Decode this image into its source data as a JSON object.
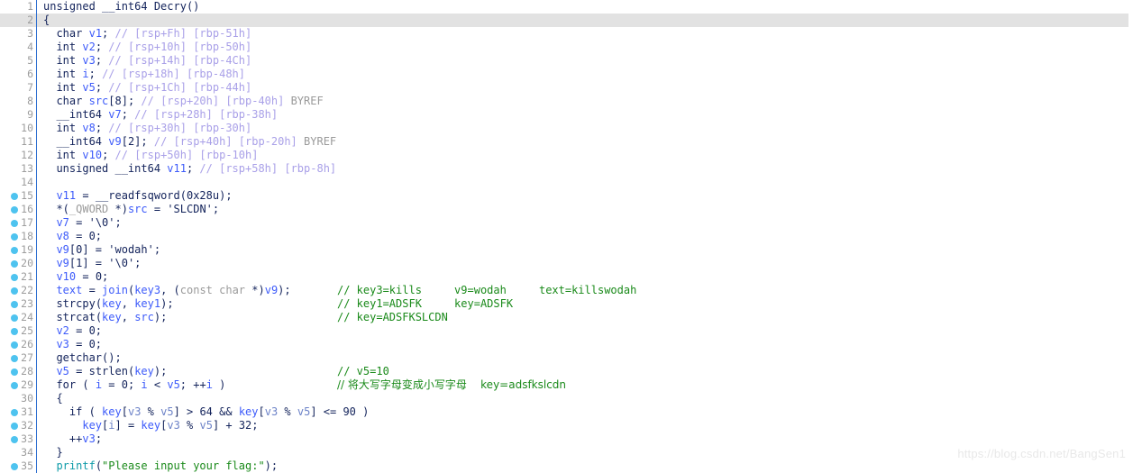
{
  "editor": {
    "title": "IDA Pseudocode - Decry",
    "language": "c",
    "colors": {
      "background": "#ffffff",
      "current_line_highlight": "#e2e2e2",
      "gutter_divider": "#2f6fd0",
      "line_number": "#9d9d9d",
      "breakpoint": "#4ec3ef",
      "keyword": "#13235b",
      "variable": "#3d5bfa",
      "comment_declaration": "#a9a0e8",
      "comment_trailing": "#1a8a1a",
      "string": "#1a8a1a",
      "library_function": "#0d9ba8",
      "gray_token": "#9a9a9a"
    },
    "watermark": "https://blog.csdn.net/BangSen1",
    "lines": [
      {
        "n": "1",
        "bp": false,
        "hl": false,
        "tokens": [
          {
            "t": "unsigned __int64 ",
            "c": "kw"
          },
          {
            "t": "Decry",
            "c": "plain"
          },
          {
            "t": "()",
            "c": "plain"
          }
        ]
      },
      {
        "n": "2",
        "bp": false,
        "hl": true,
        "tokens": [
          {
            "t": "{",
            "c": "plain"
          }
        ]
      },
      {
        "n": "3",
        "bp": false,
        "hl": false,
        "tokens": [
          {
            "t": "  ",
            "c": "plain"
          },
          {
            "t": "char",
            "c": "kw"
          },
          {
            "t": " ",
            "c": "plain"
          },
          {
            "t": "v1",
            "c": "var"
          },
          {
            "t": "; ",
            "c": "plain"
          },
          {
            "t": "// [rsp+Fh] [rbp-51h]",
            "c": "cmt"
          }
        ]
      },
      {
        "n": "4",
        "bp": false,
        "hl": false,
        "tokens": [
          {
            "t": "  ",
            "c": "plain"
          },
          {
            "t": "int",
            "c": "kw"
          },
          {
            "t": " ",
            "c": "plain"
          },
          {
            "t": "v2",
            "c": "var"
          },
          {
            "t": "; ",
            "c": "plain"
          },
          {
            "t": "// [rsp+10h] [rbp-50h]",
            "c": "cmt"
          }
        ]
      },
      {
        "n": "5",
        "bp": false,
        "hl": false,
        "tokens": [
          {
            "t": "  ",
            "c": "plain"
          },
          {
            "t": "int",
            "c": "kw"
          },
          {
            "t": " ",
            "c": "plain"
          },
          {
            "t": "v3",
            "c": "var"
          },
          {
            "t": "; ",
            "c": "plain"
          },
          {
            "t": "// [rsp+14h] [rbp-4Ch]",
            "c": "cmt"
          }
        ]
      },
      {
        "n": "6",
        "bp": false,
        "hl": false,
        "tokens": [
          {
            "t": "  ",
            "c": "plain"
          },
          {
            "t": "int",
            "c": "kw"
          },
          {
            "t": " ",
            "c": "plain"
          },
          {
            "t": "i",
            "c": "var"
          },
          {
            "t": "; ",
            "c": "plain"
          },
          {
            "t": "// [rsp+18h] [rbp-48h]",
            "c": "cmt"
          }
        ]
      },
      {
        "n": "7",
        "bp": false,
        "hl": false,
        "tokens": [
          {
            "t": "  ",
            "c": "plain"
          },
          {
            "t": "int",
            "c": "kw"
          },
          {
            "t": " ",
            "c": "plain"
          },
          {
            "t": "v5",
            "c": "var"
          },
          {
            "t": "; ",
            "c": "plain"
          },
          {
            "t": "// [rsp+1Ch] [rbp-44h]",
            "c": "cmt"
          }
        ]
      },
      {
        "n": "8",
        "bp": false,
        "hl": false,
        "tokens": [
          {
            "t": "  ",
            "c": "plain"
          },
          {
            "t": "char",
            "c": "kw"
          },
          {
            "t": " ",
            "c": "plain"
          },
          {
            "t": "src",
            "c": "var"
          },
          {
            "t": "[8]; ",
            "c": "plain"
          },
          {
            "t": "// [rsp+20h] [rbp-40h] ",
            "c": "cmt"
          },
          {
            "t": "BYREF",
            "c": "gray"
          }
        ]
      },
      {
        "n": "9",
        "bp": false,
        "hl": false,
        "tokens": [
          {
            "t": "  ",
            "c": "plain"
          },
          {
            "t": "__int64",
            "c": "kw"
          },
          {
            "t": " ",
            "c": "plain"
          },
          {
            "t": "v7",
            "c": "var"
          },
          {
            "t": "; ",
            "c": "plain"
          },
          {
            "t": "// [rsp+28h] [rbp-38h]",
            "c": "cmt"
          }
        ]
      },
      {
        "n": "10",
        "bp": false,
        "hl": false,
        "tokens": [
          {
            "t": "  ",
            "c": "plain"
          },
          {
            "t": "int",
            "c": "kw"
          },
          {
            "t": " ",
            "c": "plain"
          },
          {
            "t": "v8",
            "c": "var"
          },
          {
            "t": "; ",
            "c": "plain"
          },
          {
            "t": "// [rsp+30h] [rbp-30h]",
            "c": "cmt"
          }
        ]
      },
      {
        "n": "11",
        "bp": false,
        "hl": false,
        "tokens": [
          {
            "t": "  ",
            "c": "plain"
          },
          {
            "t": "__int64",
            "c": "kw"
          },
          {
            "t": " ",
            "c": "plain"
          },
          {
            "t": "v9",
            "c": "var"
          },
          {
            "t": "[2]; ",
            "c": "plain"
          },
          {
            "t": "// [rsp+40h] [rbp-20h] ",
            "c": "cmt"
          },
          {
            "t": "BYREF",
            "c": "gray"
          }
        ]
      },
      {
        "n": "12",
        "bp": false,
        "hl": false,
        "tokens": [
          {
            "t": "  ",
            "c": "plain"
          },
          {
            "t": "int",
            "c": "kw"
          },
          {
            "t": " ",
            "c": "plain"
          },
          {
            "t": "v10",
            "c": "var"
          },
          {
            "t": "; ",
            "c": "plain"
          },
          {
            "t": "// [rsp+50h] [rbp-10h]",
            "c": "cmt"
          }
        ]
      },
      {
        "n": "13",
        "bp": false,
        "hl": false,
        "tokens": [
          {
            "t": "  ",
            "c": "plain"
          },
          {
            "t": "unsigned __int64",
            "c": "kw"
          },
          {
            "t": " ",
            "c": "plain"
          },
          {
            "t": "v11",
            "c": "var"
          },
          {
            "t": "; ",
            "c": "plain"
          },
          {
            "t": "// [rsp+58h] [rbp-8h]",
            "c": "cmt"
          }
        ]
      },
      {
        "n": "14",
        "bp": false,
        "hl": false,
        "tokens": []
      },
      {
        "n": "15",
        "bp": true,
        "hl": false,
        "tokens": [
          {
            "t": "  ",
            "c": "plain"
          },
          {
            "t": "v11",
            "c": "var"
          },
          {
            "t": " = ",
            "c": "plain"
          },
          {
            "t": "__readfsqword",
            "c": "plain"
          },
          {
            "t": "(0x28u);",
            "c": "plain"
          }
        ]
      },
      {
        "n": "16",
        "bp": true,
        "hl": false,
        "tokens": [
          {
            "t": "  *(",
            "c": "plain"
          },
          {
            "t": "_QWORD",
            "c": "gray"
          },
          {
            "t": " *)",
            "c": "plain"
          },
          {
            "t": "src",
            "c": "var"
          },
          {
            "t": " = ",
            "c": "plain"
          },
          {
            "t": "'SLCDN';",
            "c": "plain"
          }
        ]
      },
      {
        "n": "17",
        "bp": true,
        "hl": false,
        "tokens": [
          {
            "t": "  ",
            "c": "plain"
          },
          {
            "t": "v7",
            "c": "var"
          },
          {
            "t": " = ",
            "c": "plain"
          },
          {
            "t": "'\\0';",
            "c": "plain"
          }
        ]
      },
      {
        "n": "18",
        "bp": true,
        "hl": false,
        "tokens": [
          {
            "t": "  ",
            "c": "plain"
          },
          {
            "t": "v8",
            "c": "var"
          },
          {
            "t": " = 0;",
            "c": "plain"
          }
        ]
      },
      {
        "n": "19",
        "bp": true,
        "hl": false,
        "tokens": [
          {
            "t": "  ",
            "c": "plain"
          },
          {
            "t": "v9",
            "c": "var"
          },
          {
            "t": "[0] = ",
            "c": "plain"
          },
          {
            "t": "'wodah';",
            "c": "plain"
          }
        ]
      },
      {
        "n": "20",
        "bp": true,
        "hl": false,
        "tokens": [
          {
            "t": "  ",
            "c": "plain"
          },
          {
            "t": "v9",
            "c": "var"
          },
          {
            "t": "[1] = ",
            "c": "plain"
          },
          {
            "t": "'\\0';",
            "c": "plain"
          }
        ]
      },
      {
        "n": "21",
        "bp": true,
        "hl": false,
        "tokens": [
          {
            "t": "  ",
            "c": "plain"
          },
          {
            "t": "v10",
            "c": "var"
          },
          {
            "t": " = 0;",
            "c": "plain"
          }
        ]
      },
      {
        "n": "22",
        "bp": true,
        "hl": false,
        "tokens": [
          {
            "t": "  ",
            "c": "plain"
          },
          {
            "t": "text",
            "c": "var"
          },
          {
            "t": " = ",
            "c": "plain"
          },
          {
            "t": "join",
            "c": "var"
          },
          {
            "t": "(",
            "c": "plain"
          },
          {
            "t": "key3",
            "c": "var"
          },
          {
            "t": ", (",
            "c": "plain"
          },
          {
            "t": "const char",
            "c": "gray"
          },
          {
            "t": " *)",
            "c": "plain"
          },
          {
            "t": "v9",
            "c": "var"
          },
          {
            "t": ");",
            "c": "plain"
          }
        ],
        "comment": "// key3=kills     v9=wodah     text=killswodah"
      },
      {
        "n": "23",
        "bp": true,
        "hl": false,
        "tokens": [
          {
            "t": "  ",
            "c": "plain"
          },
          {
            "t": "strcpy",
            "c": "kw"
          },
          {
            "t": "(",
            "c": "plain"
          },
          {
            "t": "key",
            "c": "var"
          },
          {
            "t": ", ",
            "c": "plain"
          },
          {
            "t": "key1",
            "c": "var"
          },
          {
            "t": ");",
            "c": "plain"
          }
        ],
        "comment": "// key1=ADSFK     key=ADSFK"
      },
      {
        "n": "24",
        "bp": true,
        "hl": false,
        "tokens": [
          {
            "t": "  ",
            "c": "plain"
          },
          {
            "t": "strcat",
            "c": "kw"
          },
          {
            "t": "(",
            "c": "plain"
          },
          {
            "t": "key",
            "c": "var"
          },
          {
            "t": ", ",
            "c": "plain"
          },
          {
            "t": "src",
            "c": "var"
          },
          {
            "t": ");",
            "c": "plain"
          }
        ],
        "comment": "// key=ADSFKSLCDN"
      },
      {
        "n": "25",
        "bp": true,
        "hl": false,
        "tokens": [
          {
            "t": "  ",
            "c": "plain"
          },
          {
            "t": "v2",
            "c": "var"
          },
          {
            "t": " = 0;",
            "c": "plain"
          }
        ]
      },
      {
        "n": "26",
        "bp": true,
        "hl": false,
        "tokens": [
          {
            "t": "  ",
            "c": "plain"
          },
          {
            "t": "v3",
            "c": "var"
          },
          {
            "t": " = 0;",
            "c": "plain"
          }
        ]
      },
      {
        "n": "27",
        "bp": true,
        "hl": false,
        "tokens": [
          {
            "t": "  ",
            "c": "plain"
          },
          {
            "t": "getchar",
            "c": "plain"
          },
          {
            "t": "();",
            "c": "plain"
          }
        ]
      },
      {
        "n": "28",
        "bp": true,
        "hl": false,
        "tokens": [
          {
            "t": "  ",
            "c": "plain"
          },
          {
            "t": "v5",
            "c": "var"
          },
          {
            "t": " = ",
            "c": "plain"
          },
          {
            "t": "strlen",
            "c": "plain"
          },
          {
            "t": "(",
            "c": "plain"
          },
          {
            "t": "key",
            "c": "var"
          },
          {
            "t": ");",
            "c": "plain"
          }
        ],
        "comment": "// v5=10"
      },
      {
        "n": "29",
        "bp": true,
        "hl": false,
        "tokens": [
          {
            "t": "  ",
            "c": "plain"
          },
          {
            "t": "for",
            "c": "kw"
          },
          {
            "t": " ( ",
            "c": "plain"
          },
          {
            "t": "i",
            "c": "var"
          },
          {
            "t": " = 0; ",
            "c": "plain"
          },
          {
            "t": "i",
            "c": "var"
          },
          {
            "t": " < ",
            "c": "plain"
          },
          {
            "t": "v5",
            "c": "var"
          },
          {
            "t": "; ++",
            "c": "plain"
          },
          {
            "t": "i",
            "c": "var"
          },
          {
            "t": " )",
            "c": "plain"
          }
        ],
        "comment": "// 将大写字母变成小写字母    key=adsfkslcdn",
        "comment_cjk": true
      },
      {
        "n": "30",
        "bp": false,
        "hl": false,
        "tokens": [
          {
            "t": "  {",
            "c": "plain"
          }
        ]
      },
      {
        "n": "31",
        "bp": true,
        "hl": false,
        "tokens": [
          {
            "t": "    ",
            "c": "plain"
          },
          {
            "t": "if",
            "c": "kw"
          },
          {
            "t": " ( ",
            "c": "plain"
          },
          {
            "t": "key",
            "c": "var"
          },
          {
            "t": "[",
            "c": "plain"
          },
          {
            "t": "v3",
            "c": "var2"
          },
          {
            "t": " % ",
            "c": "plain"
          },
          {
            "t": "v5",
            "c": "var2"
          },
          {
            "t": "] > 64 && ",
            "c": "plain"
          },
          {
            "t": "key",
            "c": "var"
          },
          {
            "t": "[",
            "c": "plain"
          },
          {
            "t": "v3",
            "c": "var2"
          },
          {
            "t": " % ",
            "c": "plain"
          },
          {
            "t": "v5",
            "c": "var2"
          },
          {
            "t": "] <= 90 )",
            "c": "plain"
          }
        ]
      },
      {
        "n": "32",
        "bp": true,
        "hl": false,
        "tokens": [
          {
            "t": "      ",
            "c": "plain"
          },
          {
            "t": "key",
            "c": "var"
          },
          {
            "t": "[",
            "c": "plain"
          },
          {
            "t": "i",
            "c": "var2"
          },
          {
            "t": "] = ",
            "c": "plain"
          },
          {
            "t": "key",
            "c": "var"
          },
          {
            "t": "[",
            "c": "plain"
          },
          {
            "t": "v3",
            "c": "var2"
          },
          {
            "t": " % ",
            "c": "plain"
          },
          {
            "t": "v5",
            "c": "var2"
          },
          {
            "t": "] + 32;",
            "c": "plain"
          }
        ]
      },
      {
        "n": "33",
        "bp": true,
        "hl": false,
        "tokens": [
          {
            "t": "    ++",
            "c": "plain"
          },
          {
            "t": "v3",
            "c": "var"
          },
          {
            "t": ";",
            "c": "plain"
          }
        ]
      },
      {
        "n": "34",
        "bp": false,
        "hl": false,
        "tokens": [
          {
            "t": "  }",
            "c": "plain"
          }
        ]
      },
      {
        "n": "35",
        "bp": true,
        "hl": false,
        "tokens": [
          {
            "t": "  ",
            "c": "plain"
          },
          {
            "t": "printf",
            "c": "fn"
          },
          {
            "t": "(",
            "c": "plain"
          },
          {
            "t": "\"Please input your flag:\"",
            "c": "str"
          },
          {
            "t": ");",
            "c": "plain"
          }
        ]
      }
    ]
  }
}
